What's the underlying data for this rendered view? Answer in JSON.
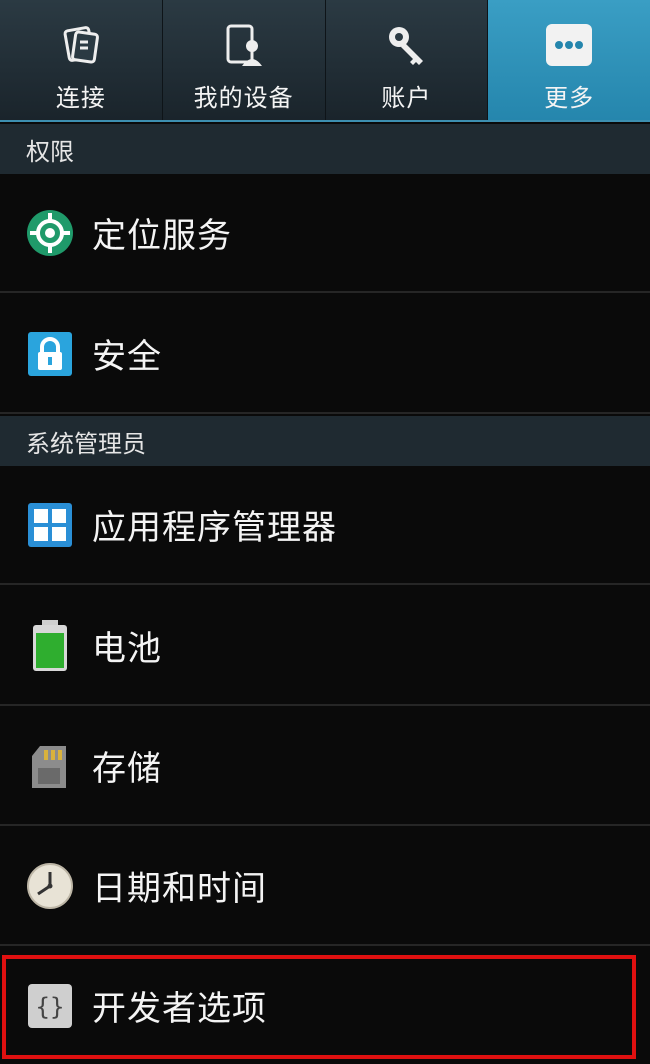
{
  "tabs": [
    {
      "label": "连接",
      "icon": "connect-icon",
      "active": false
    },
    {
      "label": "我的设备",
      "icon": "device-icon",
      "active": false
    },
    {
      "label": "账户",
      "icon": "key-icon",
      "active": false
    },
    {
      "label": "更多",
      "icon": "more-icon",
      "active": true
    }
  ],
  "sections": [
    {
      "title": "权限",
      "items": [
        {
          "label": "定位服务",
          "icon": "location-icon"
        },
        {
          "label": "安全",
          "icon": "lock-icon"
        }
      ]
    },
    {
      "title": "系统管理员",
      "items": [
        {
          "label": "应用程序管理器",
          "icon": "app-grid-icon"
        },
        {
          "label": "电池",
          "icon": "battery-icon"
        },
        {
          "label": "存储",
          "icon": "sd-card-icon"
        },
        {
          "label": "日期和时间",
          "icon": "clock-icon"
        },
        {
          "label": "开发者选项",
          "icon": "braces-icon"
        }
      ]
    }
  ],
  "colors": {
    "accent": "#2a8fb8",
    "highlight": "#e01010"
  }
}
